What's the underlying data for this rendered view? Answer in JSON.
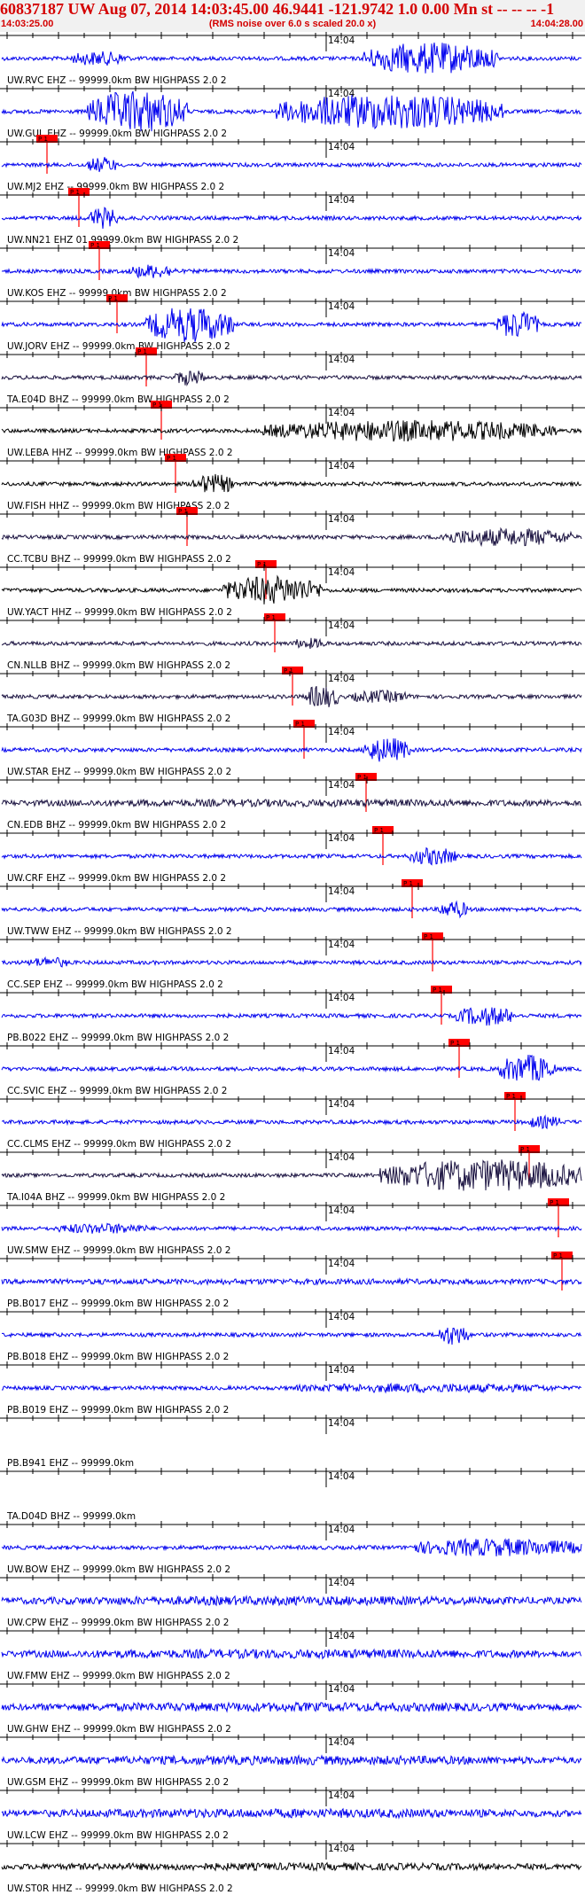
{
  "header": {
    "title": "60837187 UW Aug 07, 2014 14:03:45.00   46.9441 -121.9742  1.0 0.00 Mn st -- -- --  -1",
    "start_time": "14:03:25.00",
    "note": "(RMS noise over 6.0 s scaled 20.0 x)",
    "end_time": "14:04:28.00"
  },
  "minute_label": "14:04",
  "pick_label": "P 1",
  "colors": {
    "header_text": "#d40000",
    "pick": "#ff0000",
    "blue_trace": "#0000ee",
    "dark_trace": "#1a1240",
    "black_trace": "#000000"
  },
  "traces": [
    {
      "label": "UW.RVC EHZ -- 99999.0km BW  HIGHPASS  2.0  2",
      "color": "blue",
      "pick": null
    },
    {
      "label": "UW.GUL EHZ -- 99999.0km BW  HIGHPASS  2.0  2",
      "color": "blue",
      "pick": 0.08
    },
    {
      "label": "UW.MJ2 EHZ -- 99999.0km BW  HIGHPASS  2.0  2",
      "color": "blue",
      "pick": 0.135
    },
    {
      "label": "UW.NN21 EHZ 01 99999.0km BW  HIGHPASS  2.0  2",
      "color": "blue",
      "pick": 0.17
    },
    {
      "label": "UW.KOS EHZ -- 99999.0km BW  HIGHPASS  2.0  2",
      "color": "blue",
      "pick": 0.2
    },
    {
      "label": "UW.JORV EHZ -- 99999.0km BW  HIGHPASS  2.0  2",
      "color": "blue",
      "pick": 0.25
    },
    {
      "label": "TA.E04D BHZ -- 99999.0km BW  HIGHPASS  2.0  2",
      "color": "dark",
      "pick": 0.275
    },
    {
      "label": "UW.LEBA HHZ -- 99999.0km BW  HIGHPASS  2.0  2",
      "color": "black",
      "pick": 0.3
    },
    {
      "label": "UW.FISH HHZ -- 99999.0km BW  HIGHPASS  2.0  2",
      "color": "black",
      "pick": 0.32
    },
    {
      "label": "CC.TCBU BHZ -- 99999.0km BW  HIGHPASS  2.0  2",
      "color": "dark",
      "pick": 0.455
    },
    {
      "label": "UW.YACT HHZ -- 99999.0km BW  HIGHPASS  2.0  2",
      "color": "black",
      "pick": 0.47
    },
    {
      "label": "CN.NLLB BHZ -- 99999.0km BW  HIGHPASS  2.0  2",
      "color": "dark",
      "pick": 0.5
    },
    {
      "label": "TA.G03D BHZ -- 99999.0km BW  HIGHPASS  2.0  2",
      "color": "dark",
      "pick": 0.52
    },
    {
      "label": "UW.STAR EHZ -- 99999.0km BW  HIGHPASS  2.0  2",
      "color": "blue",
      "pick": 0.625
    },
    {
      "label": "CN.EDB BHZ -- 99999.0km BW  HIGHPASS  2.0  2",
      "color": "dark",
      "pick": 0.655
    },
    {
      "label": "UW.CRF EHZ -- 99999.0km BW  HIGHPASS  2.0  2",
      "color": "blue",
      "pick": 0.705
    },
    {
      "label": "UW.TWW EHZ -- 99999.0km BW  HIGHPASS  2.0  2",
      "color": "blue",
      "pick": 0.74
    },
    {
      "label": "CC.SEP EHZ -- 99999.0km BW  HIGHPASS  2.0  2",
      "color": "blue",
      "pick": 0.755
    },
    {
      "label": "PB.B022 EHZ -- 99999.0km BW  HIGHPASS  2.0  2",
      "color": "blue",
      "pick": 0.785
    },
    {
      "label": "CC.SVIC EHZ -- 99999.0km BW  HIGHPASS  2.0  2",
      "color": "blue",
      "pick": 0.88
    },
    {
      "label": "CC.CLMS EHZ -- 99999.0km BW  HIGHPASS  2.0  2",
      "color": "blue",
      "pick": 0.905
    },
    {
      "label": "TA.I04A BHZ -- 99999.0km BW  HIGHPASS  2.0  2",
      "color": "dark",
      "pick": 0.955
    },
    {
      "label": "UW.SMW EHZ -- 99999.0km BW  HIGHPASS  2.0  2",
      "color": "blue",
      "pick": 0.96
    },
    {
      "label": "PB.B017 EHZ -- 99999.0km BW  HIGHPASS  2.0  2",
      "color": "blue",
      "pick": null
    },
    {
      "label": "PB.B018 EHZ -- 99999.0km BW  HIGHPASS  2.0  2",
      "color": "blue",
      "pick": null
    },
    {
      "label": "PB.B019 EHZ -- 99999.0km BW  HIGHPASS  2.0  2",
      "color": "blue",
      "pick": null
    },
    {
      "label": "PB.B941 EHZ -- 99999.0km",
      "color": "blue",
      "pick": null
    },
    {
      "label": "TA.D04D BHZ -- 99999.0km",
      "color": "dark",
      "pick": null
    },
    {
      "label": "UW.BOW EHZ -- 99999.0km BW  HIGHPASS  2.0  2",
      "color": "blue",
      "pick": null
    },
    {
      "label": "UW.CPW EHZ -- 99999.0km BW  HIGHPASS  2.0  2",
      "color": "blue",
      "pick": null
    },
    {
      "label": "UW.FMW EHZ -- 99999.0km BW  HIGHPASS  2.0  2",
      "color": "blue",
      "pick": null
    },
    {
      "label": "UW.GHW EHZ -- 99999.0km BW  HIGHPASS  2.0  2",
      "color": "blue",
      "pick": null
    },
    {
      "label": "UW.GSM EHZ -- 99999.0km BW  HIGHPASS  2.0  2",
      "color": "blue",
      "pick": null
    },
    {
      "label": "UW.LCW EHZ -- 99999.0km BW  HIGHPASS  2.0  2",
      "color": "blue",
      "pick": null
    },
    {
      "label": "UW.ST0R HHZ -- 99999.0km BW  HIGHPASS  2.0  2",
      "color": "black",
      "pick": null
    }
  ]
}
